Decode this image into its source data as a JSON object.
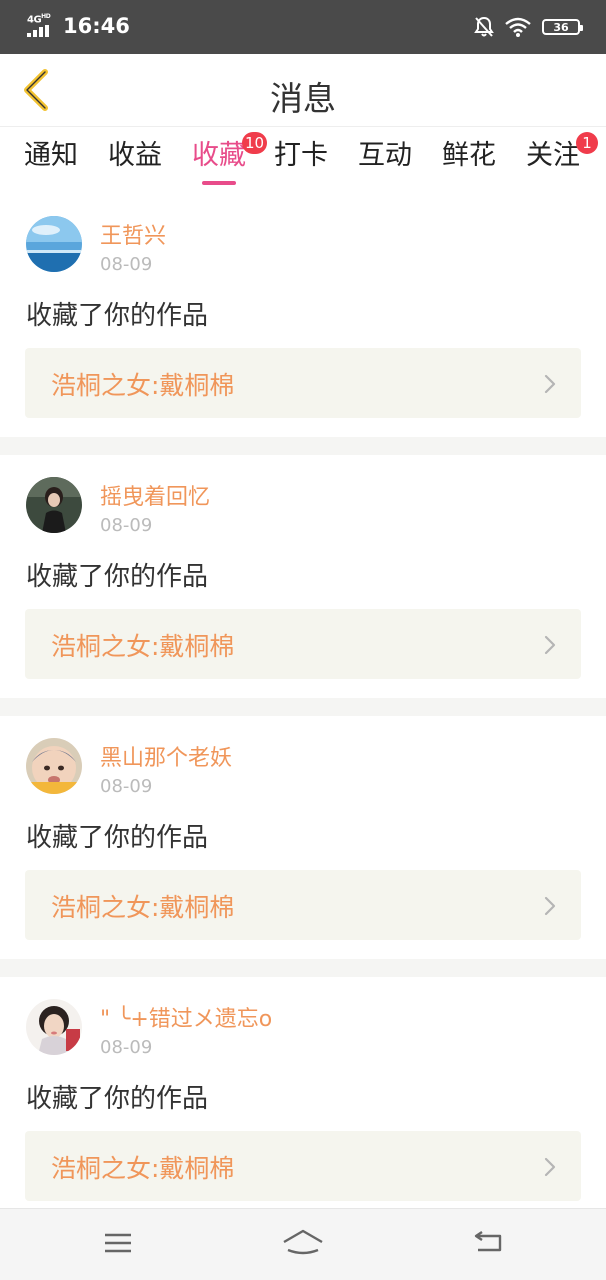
{
  "status_bar": {
    "network": "4G",
    "network_hd": "HD",
    "time": "16:46",
    "battery": "36",
    "icons": [
      "signal-icon",
      "bell-off-icon",
      "wifi-icon",
      "battery-icon"
    ]
  },
  "header": {
    "title": "消息",
    "back_icon": "chevron-left-icon"
  },
  "tabs": [
    {
      "label": "通知",
      "badge": ""
    },
    {
      "label": "收益",
      "badge": ""
    },
    {
      "label": "收藏",
      "badge": "10",
      "active": true
    },
    {
      "label": "打卡",
      "badge": ""
    },
    {
      "label": "互动",
      "badge": ""
    },
    {
      "label": "鲜花",
      "badge": ""
    },
    {
      "label": "关注",
      "badge": "1"
    }
  ],
  "notifications": [
    {
      "username": "王哲兴",
      "date": "08-09",
      "action": "收藏了你的作品",
      "work": "浩桐之女:戴桐棉"
    },
    {
      "username": "摇曳着回忆",
      "date": "08-09",
      "action": "收藏了你的作品",
      "work": "浩桐之女:戴桐棉"
    },
    {
      "username": "黑山那个老妖",
      "date": "08-09",
      "action": "收藏了你的作品",
      "work": "浩桐之女:戴桐棉"
    },
    {
      "username": "\" ╰+错过メ遗忘o",
      "date": "08-09",
      "action": "收藏了你的作品",
      "work": "浩桐之女:戴桐棉"
    }
  ],
  "nav_bar": {
    "icons": [
      "menu-icon",
      "home-icon",
      "back-icon"
    ]
  },
  "colors": {
    "accent": "#e84c8a",
    "username": "#f0965a",
    "badge": "#f03c4b",
    "back_arrow": "#f2c230"
  }
}
